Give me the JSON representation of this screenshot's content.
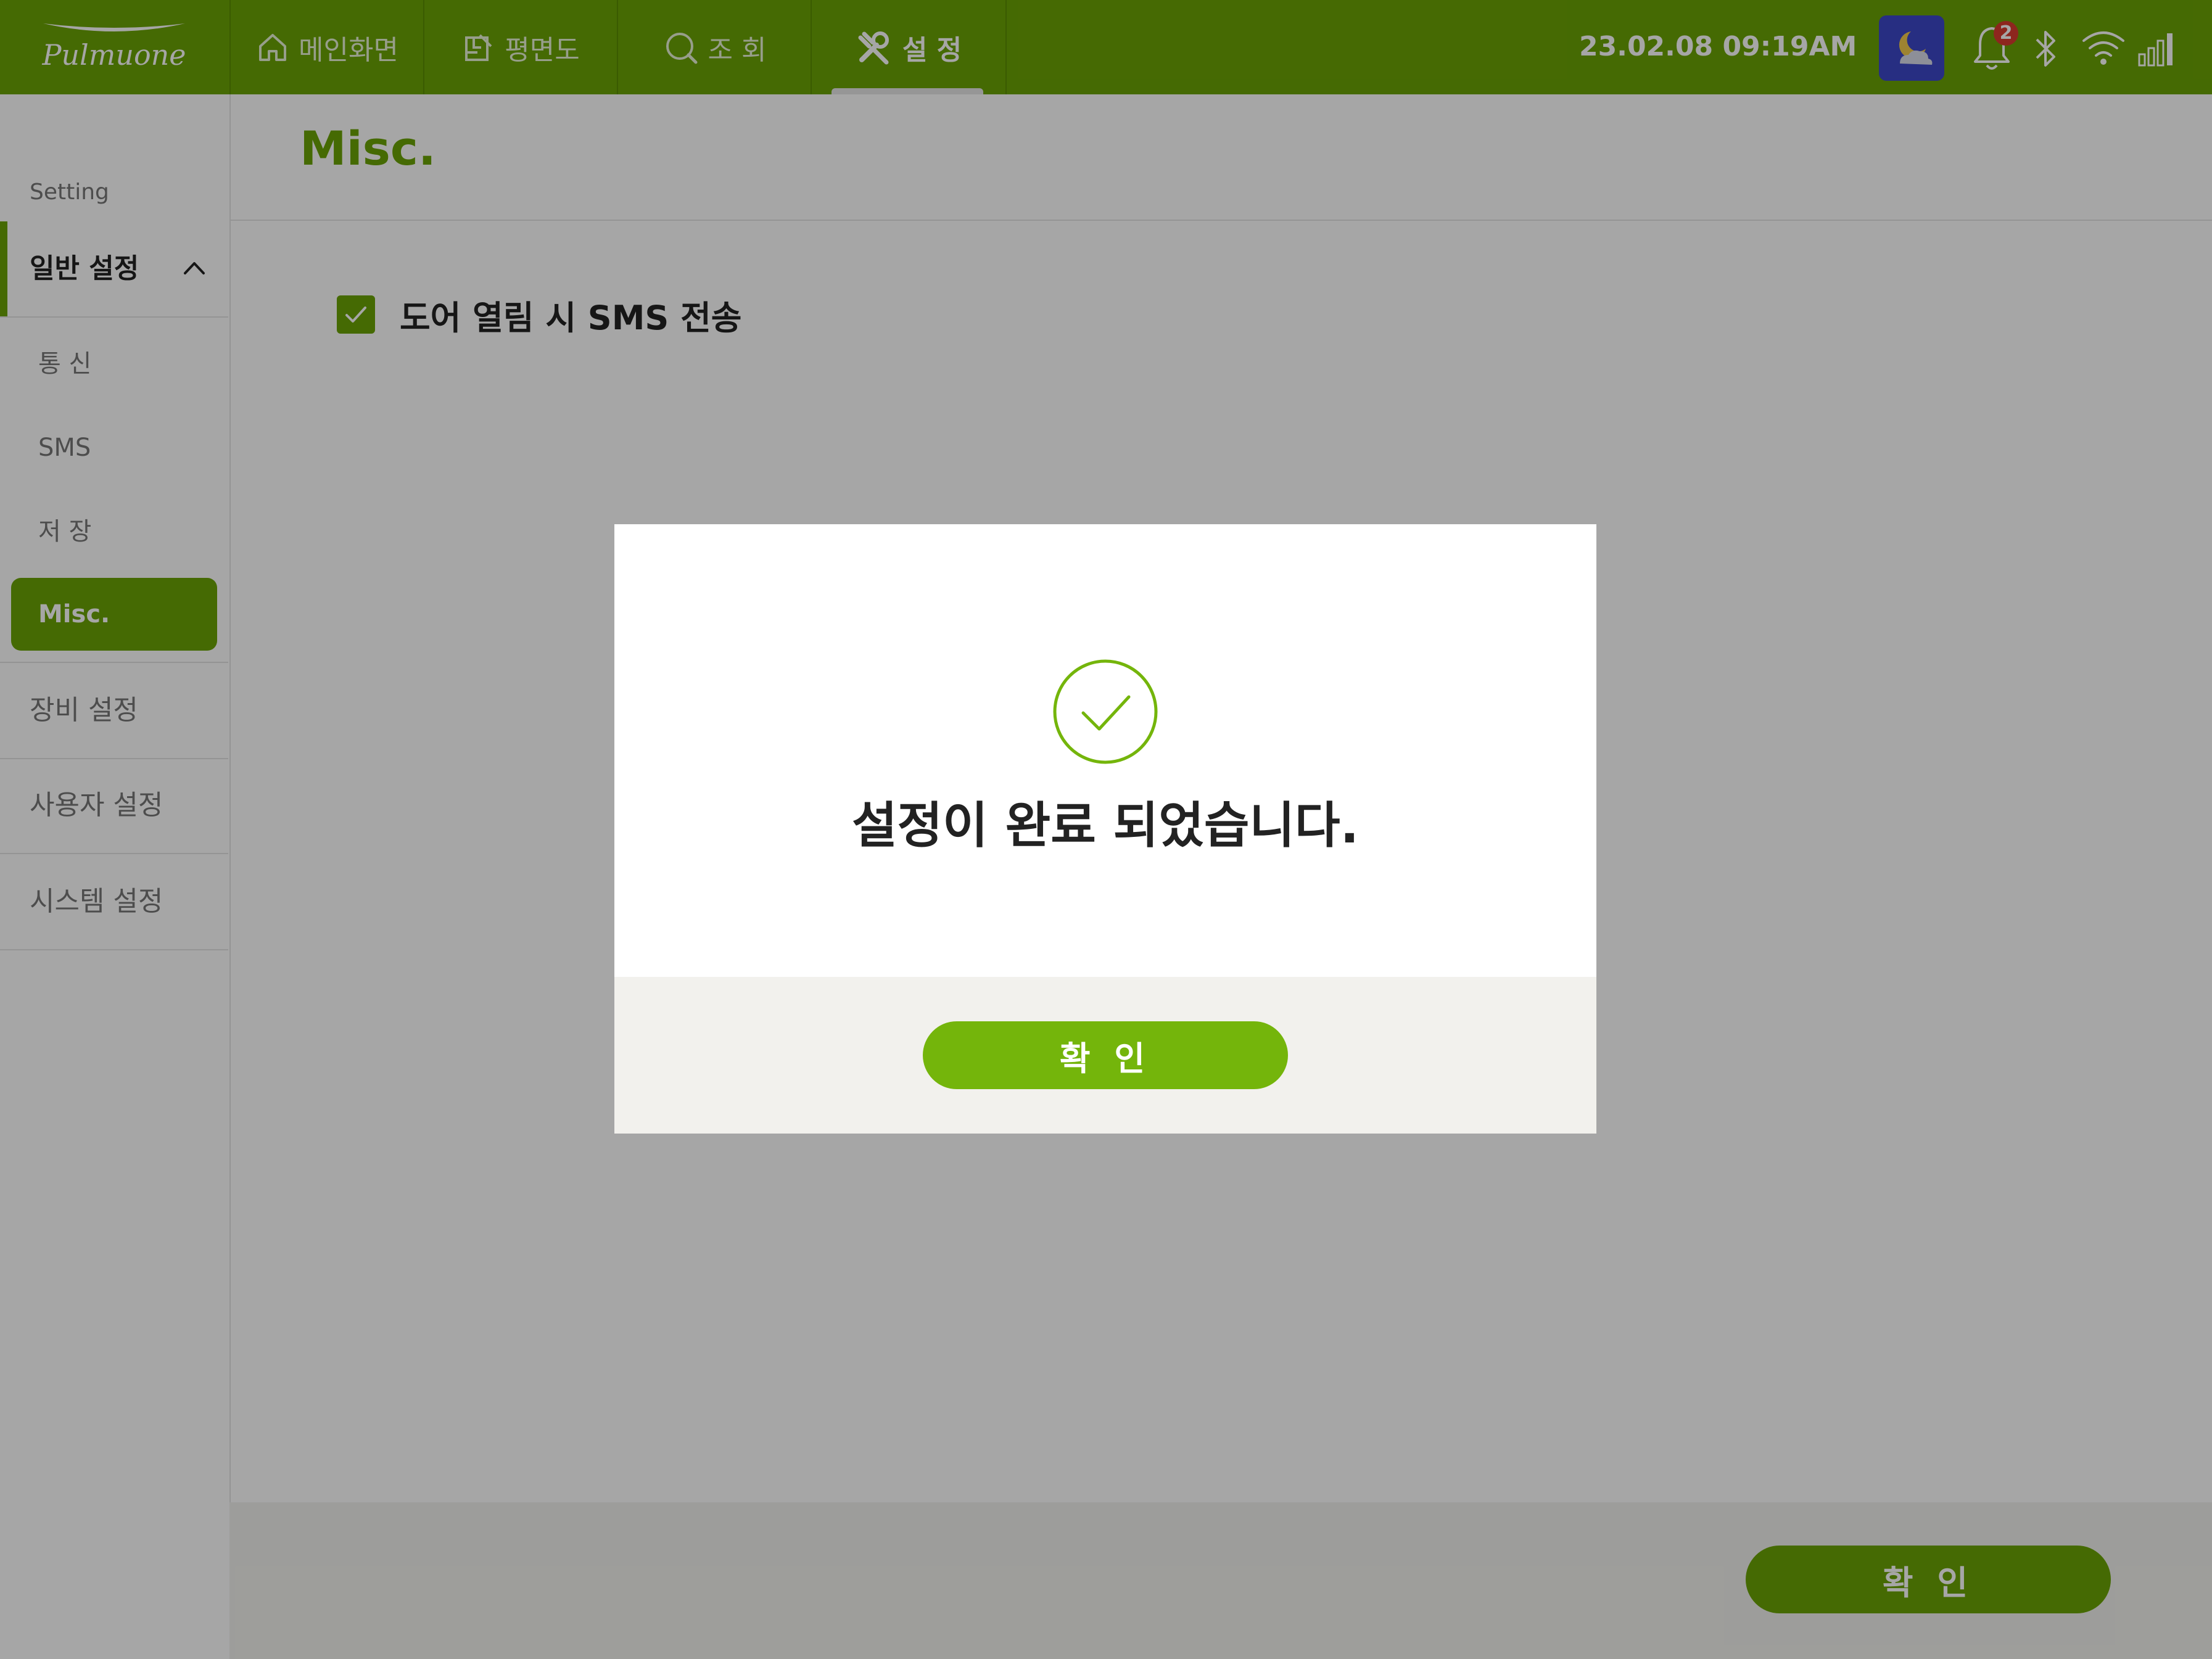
{
  "app": {
    "brand": "Pulmuone",
    "colors": {
      "brand_green": "#6ba305",
      "button_green": "#74b50b",
      "weather_tile": "#3c47c8",
      "badge_red": "#d93b2e",
      "footer_bg": "#f2f1ed"
    }
  },
  "topbar": {
    "tabs": [
      {
        "label": "메인화면",
        "icon": "home-icon"
      },
      {
        "label": "평면도",
        "icon": "floorplan-icon"
      },
      {
        "label": "조 회",
        "icon": "search-icon"
      },
      {
        "label": "설 정",
        "icon": "tools-icon",
        "active": true
      }
    ],
    "datetime": "23.02.08  09:19AM",
    "weather_icon": "moon-cloud-icon",
    "notification_count": "2",
    "status_icons": [
      "bell-icon",
      "bluetooth-icon",
      "wifi-icon",
      "signal-icon"
    ]
  },
  "sidebar": {
    "caption": "Setting",
    "groups": [
      {
        "label": "일반 설정",
        "expanded": true,
        "items": [
          {
            "label": "통 신"
          },
          {
            "label": "SMS"
          },
          {
            "label": "저 장"
          },
          {
            "label": "Misc.",
            "selected": true
          }
        ]
      },
      {
        "label": "장비 설정"
      },
      {
        "label": "사용자 설정"
      },
      {
        "label": "시스템 설정"
      }
    ]
  },
  "main": {
    "title": "Misc.",
    "option": {
      "label": "도어 열림 시 SMS 전송",
      "checked": true
    },
    "confirm_label": "확 인"
  },
  "modal": {
    "icon": "check-circle-icon",
    "message": "설정이 완료 되었습니다.",
    "ok_label": "확 인"
  }
}
